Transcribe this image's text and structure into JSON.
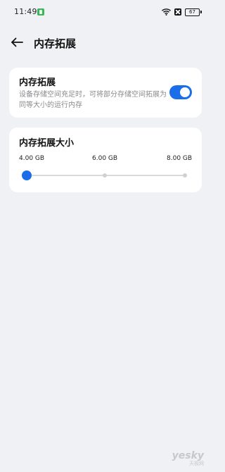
{
  "status_bar": {
    "time": "11:49",
    "battery": "67"
  },
  "header": {
    "title": "内存拓展"
  },
  "memory_toggle": {
    "title": "内存拓展",
    "description": "设备存储空间充足时，可将部分存储空间拓展为同等大小的运行内存",
    "enabled": true,
    "accent_color": "#1a6ee8"
  },
  "memory_size": {
    "title": "内存拓展大小",
    "options": [
      "4.00 GB",
      "6.00 GB",
      "8.00 GB"
    ],
    "selected": "4.00 GB",
    "selected_index": 0
  },
  "watermark": {
    "logo": "yesky",
    "sub": "天极网"
  },
  "icons": {
    "back": "arrow-left-icon",
    "wifi": "wifi-icon",
    "sim": "sim-icon",
    "battery": "battery-icon",
    "app_notification": "app-notification-icon"
  }
}
